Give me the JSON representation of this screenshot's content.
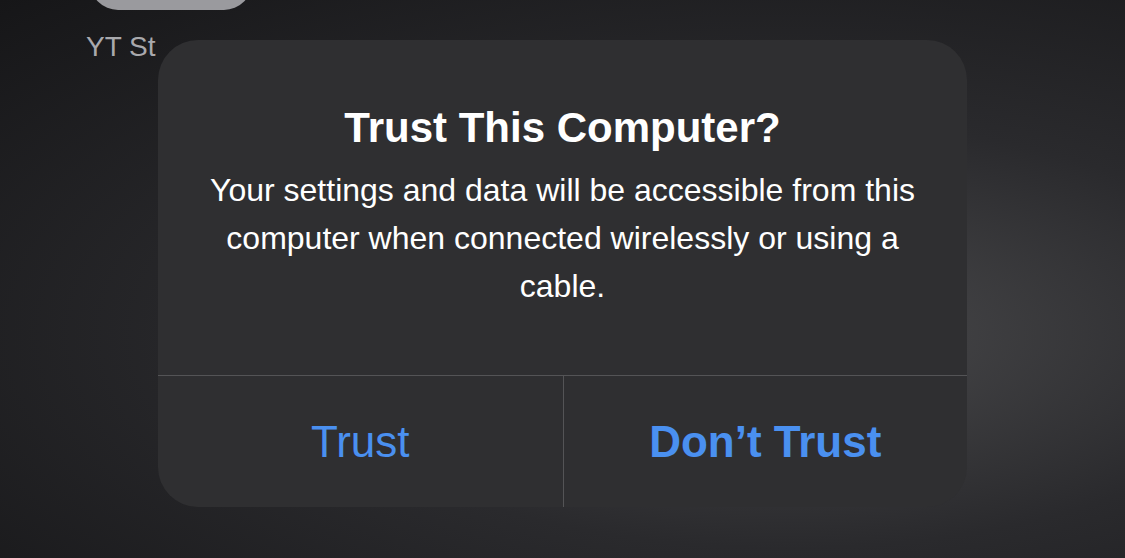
{
  "home": {
    "app_label": "YT St"
  },
  "dialog": {
    "title": "Trust This Computer?",
    "message": "Your settings and data will be accessible from this computer when connected wirelessly or using a cable.",
    "buttons": [
      {
        "label": "Trust",
        "emphasized": false
      },
      {
        "label": "Don’t Trust",
        "emphasized": true
      }
    ]
  }
}
